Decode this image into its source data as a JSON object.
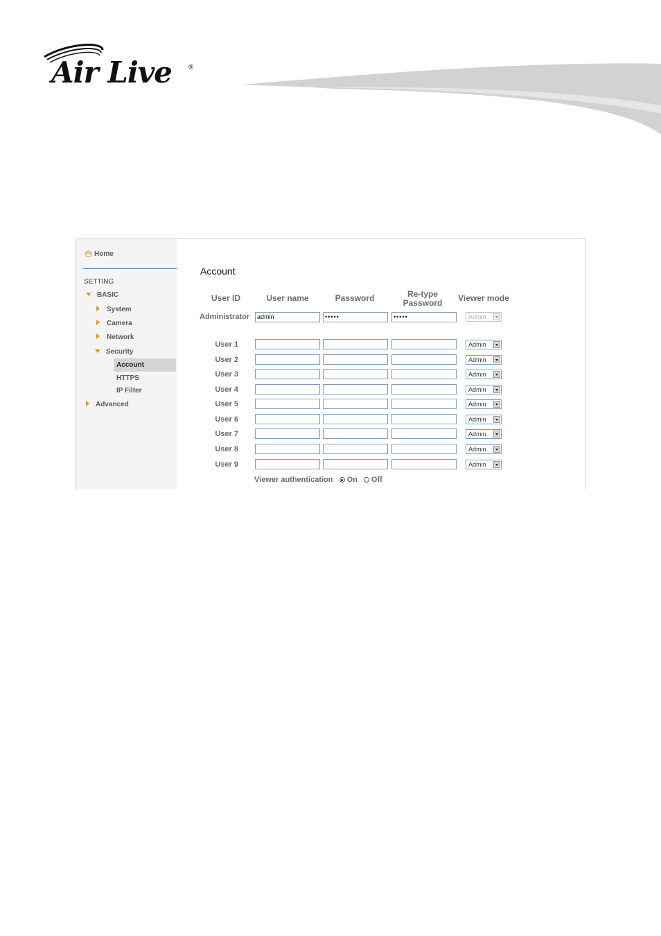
{
  "brand": {
    "logo_text": "Air Live",
    "registered": "®"
  },
  "sidebar": {
    "home": "Home",
    "section": "SETTING",
    "basic": "BASIC",
    "items": [
      "System",
      "Camera",
      "Network",
      "Security"
    ],
    "security_sub": [
      "Account",
      "HTTPS",
      "IP Filter"
    ],
    "active": "Account",
    "advanced": "Advanced"
  },
  "main": {
    "title": "Account",
    "headers": {
      "user_id": "User ID",
      "user_name": "User name",
      "password": "Password",
      "retype": "Re-type Password",
      "viewer_mode": "Viewer mode"
    },
    "admin": {
      "label": "Administrator",
      "user_name": "admin",
      "password": "•••••",
      "retype": "•••••",
      "viewer_mode": "Admin"
    },
    "users": [
      {
        "label": "User 1",
        "viewer_mode": "Admin"
      },
      {
        "label": "User 2",
        "viewer_mode": "Admin"
      },
      {
        "label": "User 3",
        "viewer_mode": "Admin"
      },
      {
        "label": "User 4",
        "viewer_mode": "Admin"
      },
      {
        "label": "User 5",
        "viewer_mode": "Admin"
      },
      {
        "label": "User 6",
        "viewer_mode": "Admin"
      },
      {
        "label": "User 7",
        "viewer_mode": "Admin"
      },
      {
        "label": "User 8",
        "viewer_mode": "Admin"
      },
      {
        "label": "User 9",
        "viewer_mode": "Admin"
      }
    ],
    "auth": {
      "label": "Viewer authentication",
      "on": "On",
      "off": "Off",
      "selected": "On"
    }
  },
  "colors": {
    "accent": "#d49a2a",
    "sidebar_bg": "#f4f4f4",
    "active_bg": "#d4d4d4",
    "input_border": "#7f9db9"
  }
}
